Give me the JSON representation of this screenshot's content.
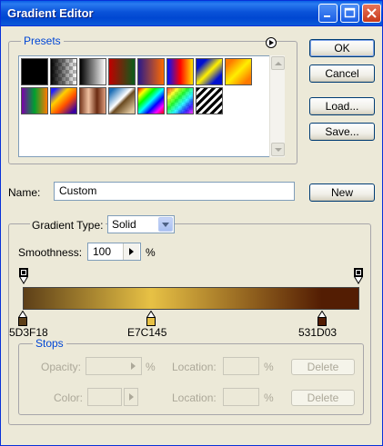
{
  "window": {
    "title": "Gradient Editor"
  },
  "buttons": {
    "ok": "OK",
    "cancel": "Cancel",
    "load": "Load...",
    "save": "Save...",
    "new": "New"
  },
  "presets": {
    "label": "Presets",
    "swatches": [
      {
        "name": "foreground-to-background",
        "css": "linear-gradient(90deg,#000,#000)"
      },
      {
        "name": "foreground-to-transparent",
        "css": "checker"
      },
      {
        "name": "black-white",
        "css": "linear-gradient(90deg,#000,#fff)"
      },
      {
        "name": "red-green",
        "css": "linear-gradient(90deg,#c00000,#0a5c1a)"
      },
      {
        "name": "violet-orange",
        "css": "linear-gradient(90deg,#2a1a8a,#ff6a00)"
      },
      {
        "name": "blue-red-yellow",
        "css": "linear-gradient(90deg,#0012ff,#ff0000,#ffe400)"
      },
      {
        "name": "blue-yellow-blue",
        "css": "linear-gradient(135deg,#0010d0 20%,#fff000 50%,#0010d0 80%)"
      },
      {
        "name": "orange-yellow-orange",
        "css": "linear-gradient(135deg,#ff7a00 15%,#ffee00 50%,#ff7a00 85%)"
      },
      {
        "name": "violet-green-orange",
        "css": "linear-gradient(90deg,#7a00aa,#00a030,#ff7a00)"
      },
      {
        "name": "yellow-violet-orange-blue",
        "css": "linear-gradient(135deg,#2020ff 10%,#ffd000 35%,#ff5000 60%,#3a00a0 90%)"
      },
      {
        "name": "copper",
        "css": "linear-gradient(90deg,#7a3a20,#f0c0a0,#6a2a10,#e0a080)"
      },
      {
        "name": "chrome",
        "css": "linear-gradient(135deg,#1d6fb6 10%,#ffffff 45%,#6a4a20 55%,#e0c8a0 90%)"
      },
      {
        "name": "spectrum",
        "css": "linear-gradient(135deg,#ff0000,#ffff00,#00ff00,#00ffff,#0000ff,#ff00ff,#ff0000)"
      },
      {
        "name": "transparent-rainbow",
        "css": "rainbow-checker"
      },
      {
        "name": "transparent-stripes",
        "css": "stripes"
      }
    ]
  },
  "name": {
    "label": "Name:",
    "value": "Custom"
  },
  "gradient": {
    "type_label": "Gradient Type:",
    "type_value": "Solid",
    "smoothness_label": "Smoothness:",
    "smoothness_value": "100",
    "percent": "%",
    "colors": [
      "#5D3F18",
      "#E7C145",
      "#531D03"
    ],
    "stop_labels": [
      "5D3F18",
      "E7C145",
      "531D03"
    ],
    "stop_positions_pct": [
      0,
      38,
      89
    ]
  },
  "stops": {
    "label": "Stops",
    "opacity_label": "Opacity:",
    "color_label": "Color:",
    "location_label": "Location:",
    "percent": "%",
    "delete": "Delete"
  }
}
